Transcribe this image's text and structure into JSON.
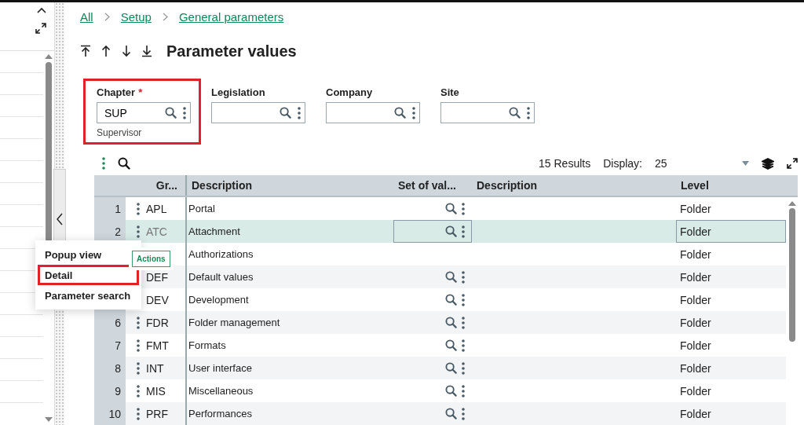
{
  "breadcrumb": [
    {
      "label": "All"
    },
    {
      "label": "Setup"
    },
    {
      "label": "General parameters"
    }
  ],
  "title": "Parameter values",
  "filters": [
    {
      "label": "Chapter",
      "required_mark": "*",
      "value": "SUP",
      "caption": "Supervisor",
      "highlighted": true
    },
    {
      "label": "Legislation",
      "highlighted": false
    },
    {
      "label": "Company",
      "highlighted": false
    },
    {
      "label": "Site",
      "highlighted": false
    }
  ],
  "results": "15 Results",
  "display_label": "Display:",
  "display_value": "25",
  "table": {
    "columns": [
      "Gr...",
      "Description",
      "Set of val...",
      "Description",
      "Level"
    ],
    "rows": [
      {
        "number": "1",
        "code": "APL",
        "description": "Portal",
        "lookup": true,
        "level": "Folder",
        "selected": false
      },
      {
        "number": "2",
        "code": "ATC",
        "description": "Attachment",
        "lookup": true,
        "level": "Folder",
        "selected": true
      },
      {
        "description": "Authorizations",
        "lookup": false,
        "level": "Folder",
        "selected": false
      },
      {
        "code": "DEF",
        "description": "Default values",
        "lookup": true,
        "level": "Folder",
        "selected": false
      },
      {
        "code": "DEV",
        "description": "Development",
        "lookup": true,
        "level": "Folder",
        "selected": false
      },
      {
        "number": "6",
        "code": "FDR",
        "description": "Folder management",
        "lookup": true,
        "level": "Folder",
        "selected": false
      },
      {
        "number": "7",
        "code": "FMT",
        "description": "Formats",
        "lookup": true,
        "level": "Folder",
        "selected": false
      },
      {
        "number": "8",
        "code": "INT",
        "description": "User interface",
        "lookup": true,
        "level": "Folder",
        "selected": false
      },
      {
        "number": "9",
        "code": "MIS",
        "description": "Miscellaneous",
        "lookup": true,
        "level": "Folder",
        "selected": false
      },
      {
        "number": "10",
        "code": "PRF",
        "description": "Performances",
        "lookup": true,
        "level": "Folder",
        "selected": false
      }
    ]
  },
  "context_menu": {
    "items": [
      {
        "label": "Popup view",
        "selected": false
      },
      {
        "label": "Detail",
        "selected": true
      },
      {
        "label": "Parameter search",
        "selected": false
      }
    ],
    "tooltip": "Actions"
  }
}
